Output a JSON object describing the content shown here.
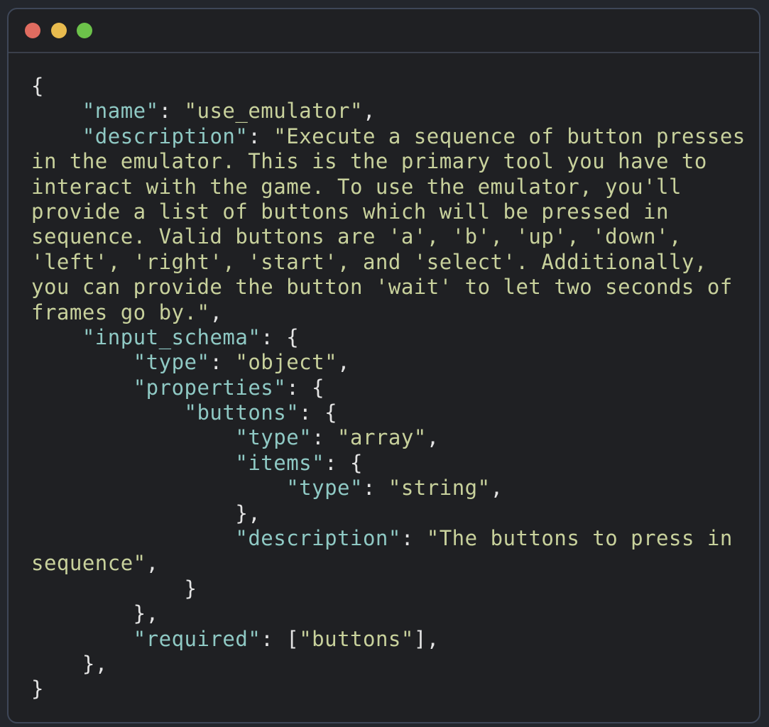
{
  "window": {
    "controls": [
      {
        "name": "close",
        "color": "#e06c60"
      },
      {
        "name": "minimize",
        "color": "#e8bb4e"
      },
      {
        "name": "maximize",
        "color": "#6cc24a"
      }
    ]
  },
  "colors": {
    "background": "#1f2023",
    "key": "#8fc9c4",
    "string": "#c8d19c",
    "punctuation": "#e3e3e3"
  },
  "code": {
    "lines": [
      [
        {
          "t": "p",
          "v": "{"
        }
      ],
      [
        {
          "t": "p",
          "v": "    "
        },
        {
          "t": "k",
          "v": "\"name\""
        },
        {
          "t": "p",
          "v": ": "
        },
        {
          "t": "s",
          "v": "\"use_emulator\""
        },
        {
          "t": "p",
          "v": ","
        }
      ],
      [
        {
          "t": "p",
          "v": "    "
        },
        {
          "t": "k",
          "v": "\"description\""
        },
        {
          "t": "p",
          "v": ": "
        },
        {
          "t": "s",
          "v": "\"Execute a sequence of button presses"
        }
      ],
      [
        {
          "t": "s",
          "v": "in the emulator. This is the primary tool you have to"
        }
      ],
      [
        {
          "t": "s",
          "v": "interact with the game. To use the emulator, you'll"
        }
      ],
      [
        {
          "t": "s",
          "v": "provide a list of buttons which will be pressed in"
        }
      ],
      [
        {
          "t": "s",
          "v": "sequence. Valid buttons are 'a', 'b', 'up', 'down',"
        }
      ],
      [
        {
          "t": "s",
          "v": "'left', 'right', 'start', and 'select'. Additionally,"
        }
      ],
      [
        {
          "t": "s",
          "v": "you can provide the button 'wait' to let two seconds of"
        }
      ],
      [
        {
          "t": "s",
          "v": "frames go by.\""
        },
        {
          "t": "p",
          "v": ","
        }
      ],
      [
        {
          "t": "p",
          "v": "    "
        },
        {
          "t": "k",
          "v": "\"input_schema\""
        },
        {
          "t": "p",
          "v": ": {"
        }
      ],
      [
        {
          "t": "p",
          "v": "        "
        },
        {
          "t": "k",
          "v": "\"type\""
        },
        {
          "t": "p",
          "v": ": "
        },
        {
          "t": "s",
          "v": "\"object\""
        },
        {
          "t": "p",
          "v": ","
        }
      ],
      [
        {
          "t": "p",
          "v": "        "
        },
        {
          "t": "k",
          "v": "\"properties\""
        },
        {
          "t": "p",
          "v": ": {"
        }
      ],
      [
        {
          "t": "p",
          "v": "            "
        },
        {
          "t": "k",
          "v": "\"buttons\""
        },
        {
          "t": "p",
          "v": ": {"
        }
      ],
      [
        {
          "t": "p",
          "v": "                "
        },
        {
          "t": "k",
          "v": "\"type\""
        },
        {
          "t": "p",
          "v": ": "
        },
        {
          "t": "s",
          "v": "\"array\""
        },
        {
          "t": "p",
          "v": ","
        }
      ],
      [
        {
          "t": "p",
          "v": "                "
        },
        {
          "t": "k",
          "v": "\"items\""
        },
        {
          "t": "p",
          "v": ": {"
        }
      ],
      [
        {
          "t": "p",
          "v": "                    "
        },
        {
          "t": "k",
          "v": "\"type\""
        },
        {
          "t": "p",
          "v": ": "
        },
        {
          "t": "s",
          "v": "\"string\""
        },
        {
          "t": "p",
          "v": ","
        }
      ],
      [
        {
          "t": "p",
          "v": "                },"
        }
      ],
      [
        {
          "t": "p",
          "v": "                "
        },
        {
          "t": "k",
          "v": "\"description\""
        },
        {
          "t": "p",
          "v": ": "
        },
        {
          "t": "s",
          "v": "\"The buttons to press in"
        }
      ],
      [
        {
          "t": "s",
          "v": "sequence\""
        },
        {
          "t": "p",
          "v": ","
        }
      ],
      [
        {
          "t": "p",
          "v": "            }"
        }
      ],
      [
        {
          "t": "p",
          "v": "        },"
        }
      ],
      [
        {
          "t": "p",
          "v": "        "
        },
        {
          "t": "k",
          "v": "\"required\""
        },
        {
          "t": "p",
          "v": ": ["
        },
        {
          "t": "s",
          "v": "\"buttons\""
        },
        {
          "t": "p",
          "v": "],"
        }
      ],
      [
        {
          "t": "p",
          "v": "    },"
        }
      ],
      [
        {
          "t": "p",
          "v": "}"
        }
      ]
    ]
  }
}
